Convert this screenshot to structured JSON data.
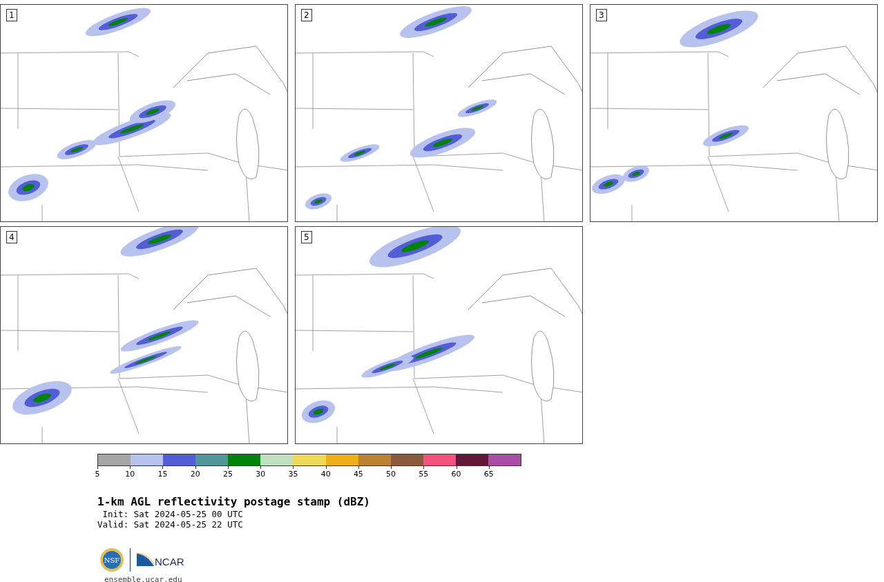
{
  "panels": [
    {
      "label": "1"
    },
    {
      "label": "2"
    },
    {
      "label": "3"
    },
    {
      "label": "4"
    },
    {
      "label": "5"
    }
  ],
  "colorbar": {
    "bins": [
      {
        "label": "5",
        "color": "#a5a5a5"
      },
      {
        "label": "10",
        "color": "#b8c2ee"
      },
      {
        "label": "15",
        "color": "#535ed6"
      },
      {
        "label": "20",
        "color": "#50969b"
      },
      {
        "label": "25",
        "color": "#00820b"
      },
      {
        "label": "30",
        "color": "#bfdfbf"
      },
      {
        "label": "35",
        "color": "#efd95b"
      },
      {
        "label": "40",
        "color": "#eeb01a"
      },
      {
        "label": "45",
        "color": "#bb8232"
      },
      {
        "label": "50",
        "color": "#8b5a3c"
      },
      {
        "label": "55",
        "color": "#f4517d"
      },
      {
        "label": "60",
        "color": "#641838"
      },
      {
        "label": "65",
        "color": "#a84ca4"
      }
    ]
  },
  "title": "1-km AGL reflectivity postage stamp (dBZ)",
  "init": " Init: Sat 2024-05-25 00 UTC",
  "valid": "Valid: Sat 2024-05-25 22 UTC",
  "logos": {
    "nsf": "NSF",
    "ncar": "NCAR"
  },
  "footer_url": "ensemble.ucar.edu"
}
